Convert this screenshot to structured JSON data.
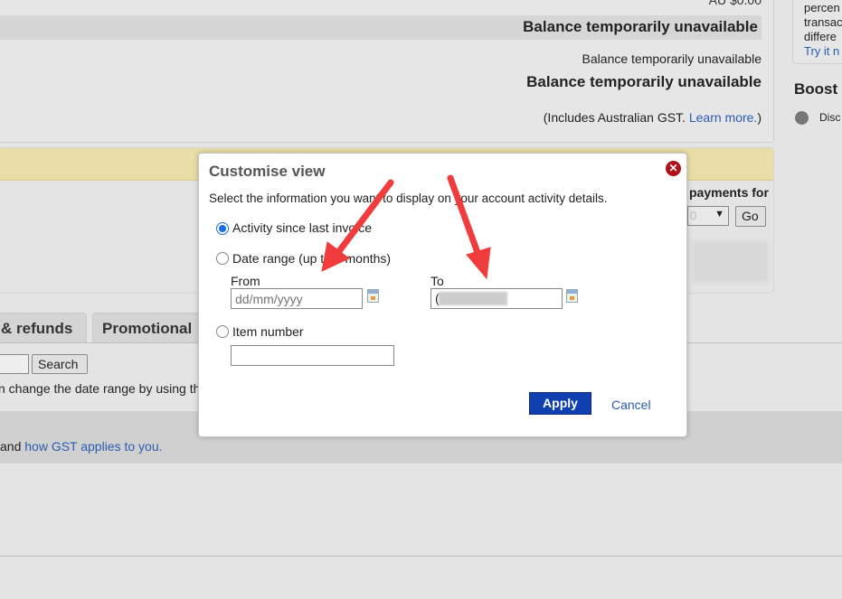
{
  "summary": {
    "amount_cut": "AU $0.00",
    "balance_bold_1": "Balance temporarily unavailable",
    "balance_small": "Balance temporarily unavailable",
    "balance_bold_2": "Balance temporarily unavailable",
    "gst_note_prefix": "(Includes Australian GST. ",
    "gst_learn_more": "Learn more.",
    "gst_note_suffix": ")"
  },
  "sidebar": {
    "lines": [
      "percen",
      "transac",
      "differe"
    ],
    "link": "Try it n",
    "boost_title": "Boost",
    "boost_item": "Disc"
  },
  "payments": {
    "label": "payments for",
    "select_value": "0",
    "go": "Go"
  },
  "tabs": [
    {
      "label": "& refunds"
    },
    {
      "label": "Promotional"
    }
  ],
  "search": {
    "value": "",
    "button": "Search"
  },
  "hint_text": "n change the date range by using th",
  "gst": {
    "prefix": "and ",
    "link": "how GST applies to you."
  },
  "dialog": {
    "title": "Customise view",
    "description": "Select the information you want to display on your account activity details.",
    "options": [
      {
        "label": "Activity since last invoice",
        "selected": true
      },
      {
        "label": "Date range (up to 4 months)",
        "selected": false
      },
      {
        "label": "Item number",
        "selected": false
      }
    ],
    "from_label": "From",
    "from_placeholder": "dd/mm/yyyy",
    "from_value": "",
    "to_label": "To",
    "to_value": "(",
    "item_number_value": "",
    "apply": "Apply",
    "cancel": "Cancel"
  },
  "colors": {
    "accent": "#1040b0",
    "arrow": "#f03c3c",
    "link": "#2a5db0",
    "close": "#b0101a"
  }
}
